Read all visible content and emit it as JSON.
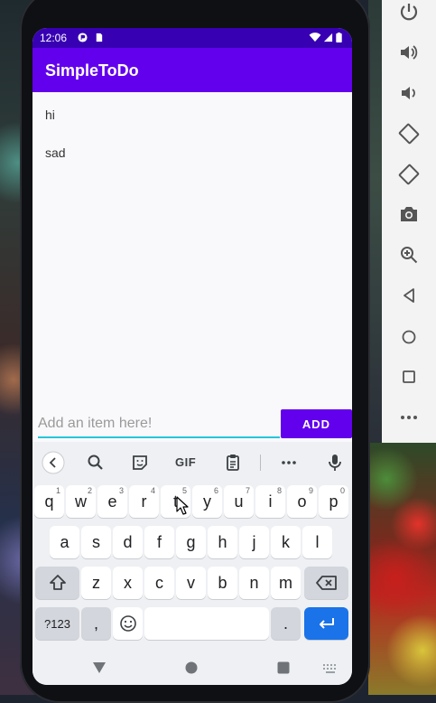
{
  "statusbar": {
    "time": "12:06"
  },
  "appbar": {
    "title": "SimpleToDo"
  },
  "items": [
    "hi",
    "sad"
  ],
  "input": {
    "placeholder": "Add an item here!",
    "value": ""
  },
  "add_button": {
    "label": "ADD"
  },
  "keyboard": {
    "row1": [
      {
        "k": "q",
        "h": "1"
      },
      {
        "k": "w",
        "h": "2"
      },
      {
        "k": "e",
        "h": "3"
      },
      {
        "k": "r",
        "h": "4"
      },
      {
        "k": "t",
        "h": "5"
      },
      {
        "k": "y",
        "h": "6"
      },
      {
        "k": "u",
        "h": "7"
      },
      {
        "k": "i",
        "h": "8"
      },
      {
        "k": "o",
        "h": "9"
      },
      {
        "k": "p",
        "h": "0"
      }
    ],
    "row2": [
      "a",
      "s",
      "d",
      "f",
      "g",
      "h",
      "j",
      "k",
      "l"
    ],
    "row3": [
      "z",
      "x",
      "c",
      "v",
      "b",
      "n",
      "m"
    ],
    "symbols_label": "?123",
    "comma_label": ",",
    "period_label": ".",
    "gif_label": "GIF"
  },
  "colors": {
    "primary": "#6200ee",
    "primary_dark": "#3700b3",
    "accent": "#26c6da",
    "enter_key": "#1a73e8"
  }
}
